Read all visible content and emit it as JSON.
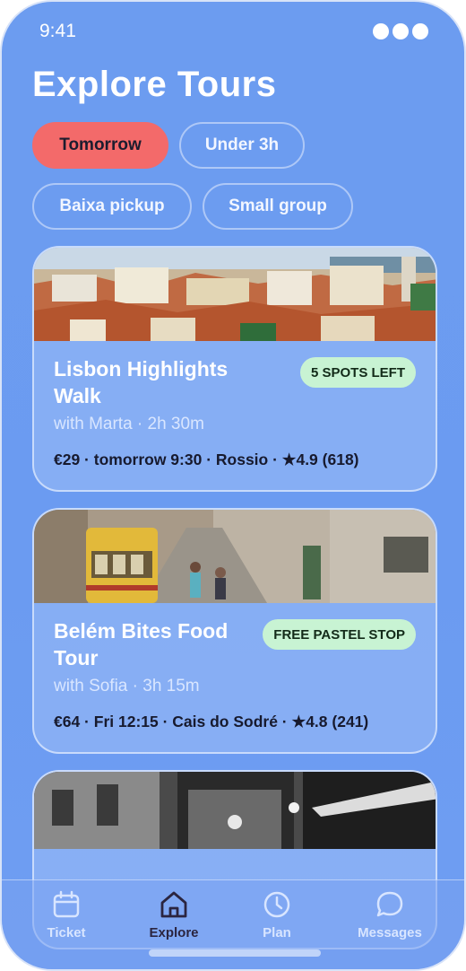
{
  "status_bar": {
    "time": "9:41"
  },
  "page": {
    "title": "Explore Tours"
  },
  "filters": [
    {
      "label": "Tomorrow",
      "active": true
    },
    {
      "label": "Under 3h",
      "active": false
    },
    {
      "label": "Baixa pickup",
      "active": false
    },
    {
      "label": "Small group",
      "active": false
    }
  ],
  "tours": [
    {
      "title": "Lisbon Highlights Walk",
      "badge": "5 SPOTS LEFT",
      "guide": "with Marta · 2h 30m",
      "meta": "€29 · tomorrow 9:30 · Rossio · ★4.9 (618)"
    },
    {
      "title": "Belém Bites Food Tour",
      "badge": "FREE PASTEL STOP",
      "guide": "with Sofia · 3h 15m",
      "meta": "€64 · Fri 12:15 · Cais do Sodré · ★4.8 (241)"
    }
  ],
  "tabbar": {
    "items": [
      {
        "label": "Ticket",
        "icon": "calendar-icon"
      },
      {
        "label": "Explore",
        "icon": "home-icon",
        "active": true
      },
      {
        "label": "Plan",
        "icon": "clock-icon"
      },
      {
        "label": "Messages",
        "icon": "chat-bubble-icon"
      }
    ]
  },
  "colors": {
    "accent": "#f36a6a",
    "background": "#6c9cf0",
    "badge": "#c8f3d3"
  }
}
